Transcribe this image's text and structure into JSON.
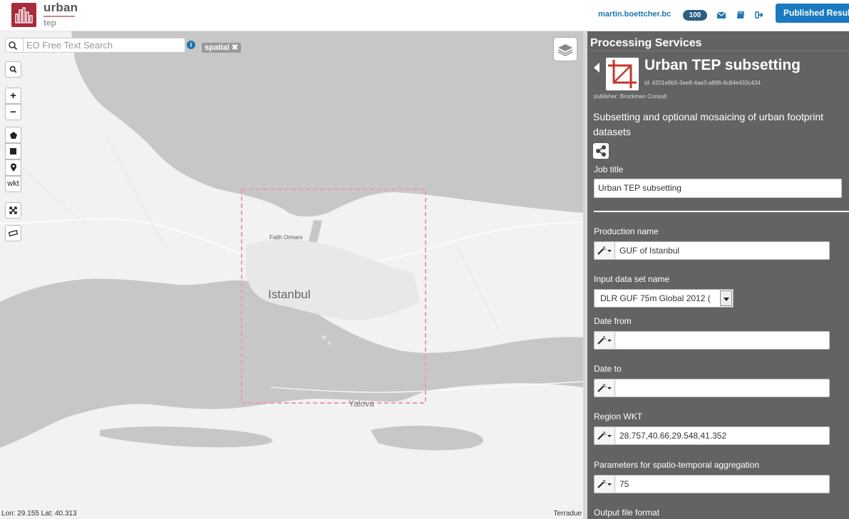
{
  "header": {
    "logo_line1": "urban",
    "logo_line2": "tep",
    "username": "martin.boettcher.bc",
    "credits": "100",
    "published_button": "Published Results",
    "icons": [
      "envelope-icon",
      "book-icon",
      "sign-out-icon"
    ]
  },
  "map": {
    "search_placeholder": "EO Free Text Search",
    "search_value": "",
    "filter_tag": "spatial",
    "tools": {
      "zoom_in": "+",
      "zoom_out": "−",
      "wkt": "wkt"
    },
    "labels": {
      "city": "Istanbul",
      "district": "Fatih Ormanı",
      "town": "Yalova"
    },
    "coordinates": "Lon: 29.155 Lat: 40.313",
    "attribution": "Terradue",
    "colors": {
      "land": "#f2f2f2",
      "water": "#c7c7c7",
      "selection": "#e89bb3"
    }
  },
  "panel": {
    "title": "Processing Services",
    "service": {
      "name": "Urban TEP subsetting",
      "id": "id: 4201e8b5-3ee8-4ae3-a896-6c84e433c434",
      "publisher": "publisher: Brockman Consult",
      "description": "Subsetting and optional mosaicing of urban footprint datasets"
    },
    "job_title_label": "Job title",
    "job_title_value": "Urban TEP subsetting",
    "fields": {
      "production_name": {
        "label": "Production name",
        "value": "GUF of Istanbul"
      },
      "input_dataset": {
        "label": "Input data set name",
        "value": "DLR GUF 75m Global 2012 ("
      },
      "date_from": {
        "label": "Date from",
        "value": ""
      },
      "date_to": {
        "label": "Date to",
        "value": ""
      },
      "region_wkt": {
        "label": "Region WKT",
        "value": "28.757,40.66,29.548,41.352"
      },
      "aggregation": {
        "label": "Parameters for spatio-temporal aggregation",
        "value": "75"
      },
      "output_format": {
        "label": "Output file format"
      }
    },
    "colors": {
      "background": "#636363",
      "accent": "#1a7abf",
      "icon_red": "#c0392b"
    }
  }
}
